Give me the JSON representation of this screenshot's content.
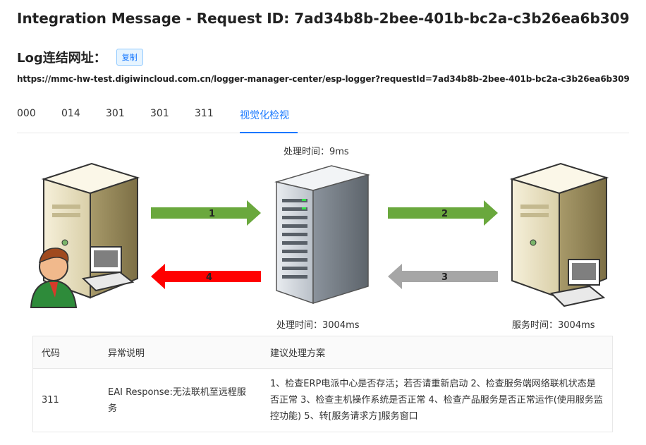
{
  "title": "Integration Message - Request ID: 7ad34b8b-2bee-401b-bc2a-c3b26ea6b309",
  "log": {
    "label": "Log连结网址：",
    "copy_label": "复制",
    "url": "https://mmc-hw-test.digiwincloud.com.cn/logger-manager-center/esp-logger?requestId=7ad34b8b-2bee-401b-bc2a-c3b26ea6b309"
  },
  "tabs": [
    "000",
    "014",
    "301",
    "301",
    "311",
    "视觉化检视"
  ],
  "active_tab": "视觉化检视",
  "diagram": {
    "top_time": "处理时间：9ms",
    "bottom_mid_time": "处理时间：3004ms",
    "bottom_right_time": "服务时间：3004ms",
    "arrows": [
      {
        "label": "1",
        "color": "#6aa83d"
      },
      {
        "label": "2",
        "color": "#6aa83d"
      },
      {
        "label": "3",
        "color": "#a6a6a6"
      },
      {
        "label": "4",
        "color": "#ff0000"
      }
    ]
  },
  "table": {
    "headers": [
      "代码",
      "异常说明",
      "建议处理方案"
    ],
    "rows": [
      {
        "code": "311",
        "desc": "EAI Response:无法联机至远程服务",
        "suggestion": "1、检查ERP电派中心是否存活；若否请重新启动 2、检查服务端网络联机状态是否正常 3、检查主机操作系统是否正常 4、检查产品服务是否正常运作(使用服务监控功能) 5、转[服务请求方]服务窗口"
      }
    ]
  }
}
